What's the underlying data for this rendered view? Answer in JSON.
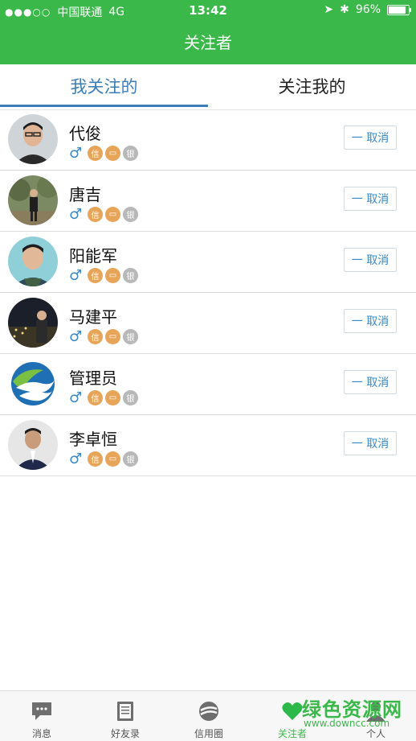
{
  "status_bar": {
    "carrier": "中国联通",
    "network": "4G",
    "time": "13:42",
    "battery": "96%"
  },
  "nav": {
    "title": "关注者"
  },
  "tabs": [
    {
      "label": "我关注的"
    },
    {
      "label": "关注我的"
    }
  ],
  "badge_text": {
    "xin": "信",
    "yin": "银"
  },
  "cancel_label": "一 取消",
  "users": [
    {
      "name": "代俊"
    },
    {
      "name": "唐吉"
    },
    {
      "name": "阳能军"
    },
    {
      "name": "马建平"
    },
    {
      "name": "管理员"
    },
    {
      "name": "李卓恒"
    }
  ],
  "bottom_nav": [
    {
      "label": "消息",
      "icon": "message-icon"
    },
    {
      "label": "好友录",
      "icon": "book-icon"
    },
    {
      "label": "信用圈",
      "icon": "circle-logo-icon"
    },
    {
      "label": "关注者",
      "icon": "heart-icon"
    },
    {
      "label": "个人",
      "icon": "person-icon"
    }
  ],
  "watermark": {
    "text": "绿色资源网",
    "sub": "www.downcc.com"
  },
  "colors": {
    "brand": "#3bb84a",
    "tab_active": "#3a7db8",
    "link": "#3a88c8"
  }
}
